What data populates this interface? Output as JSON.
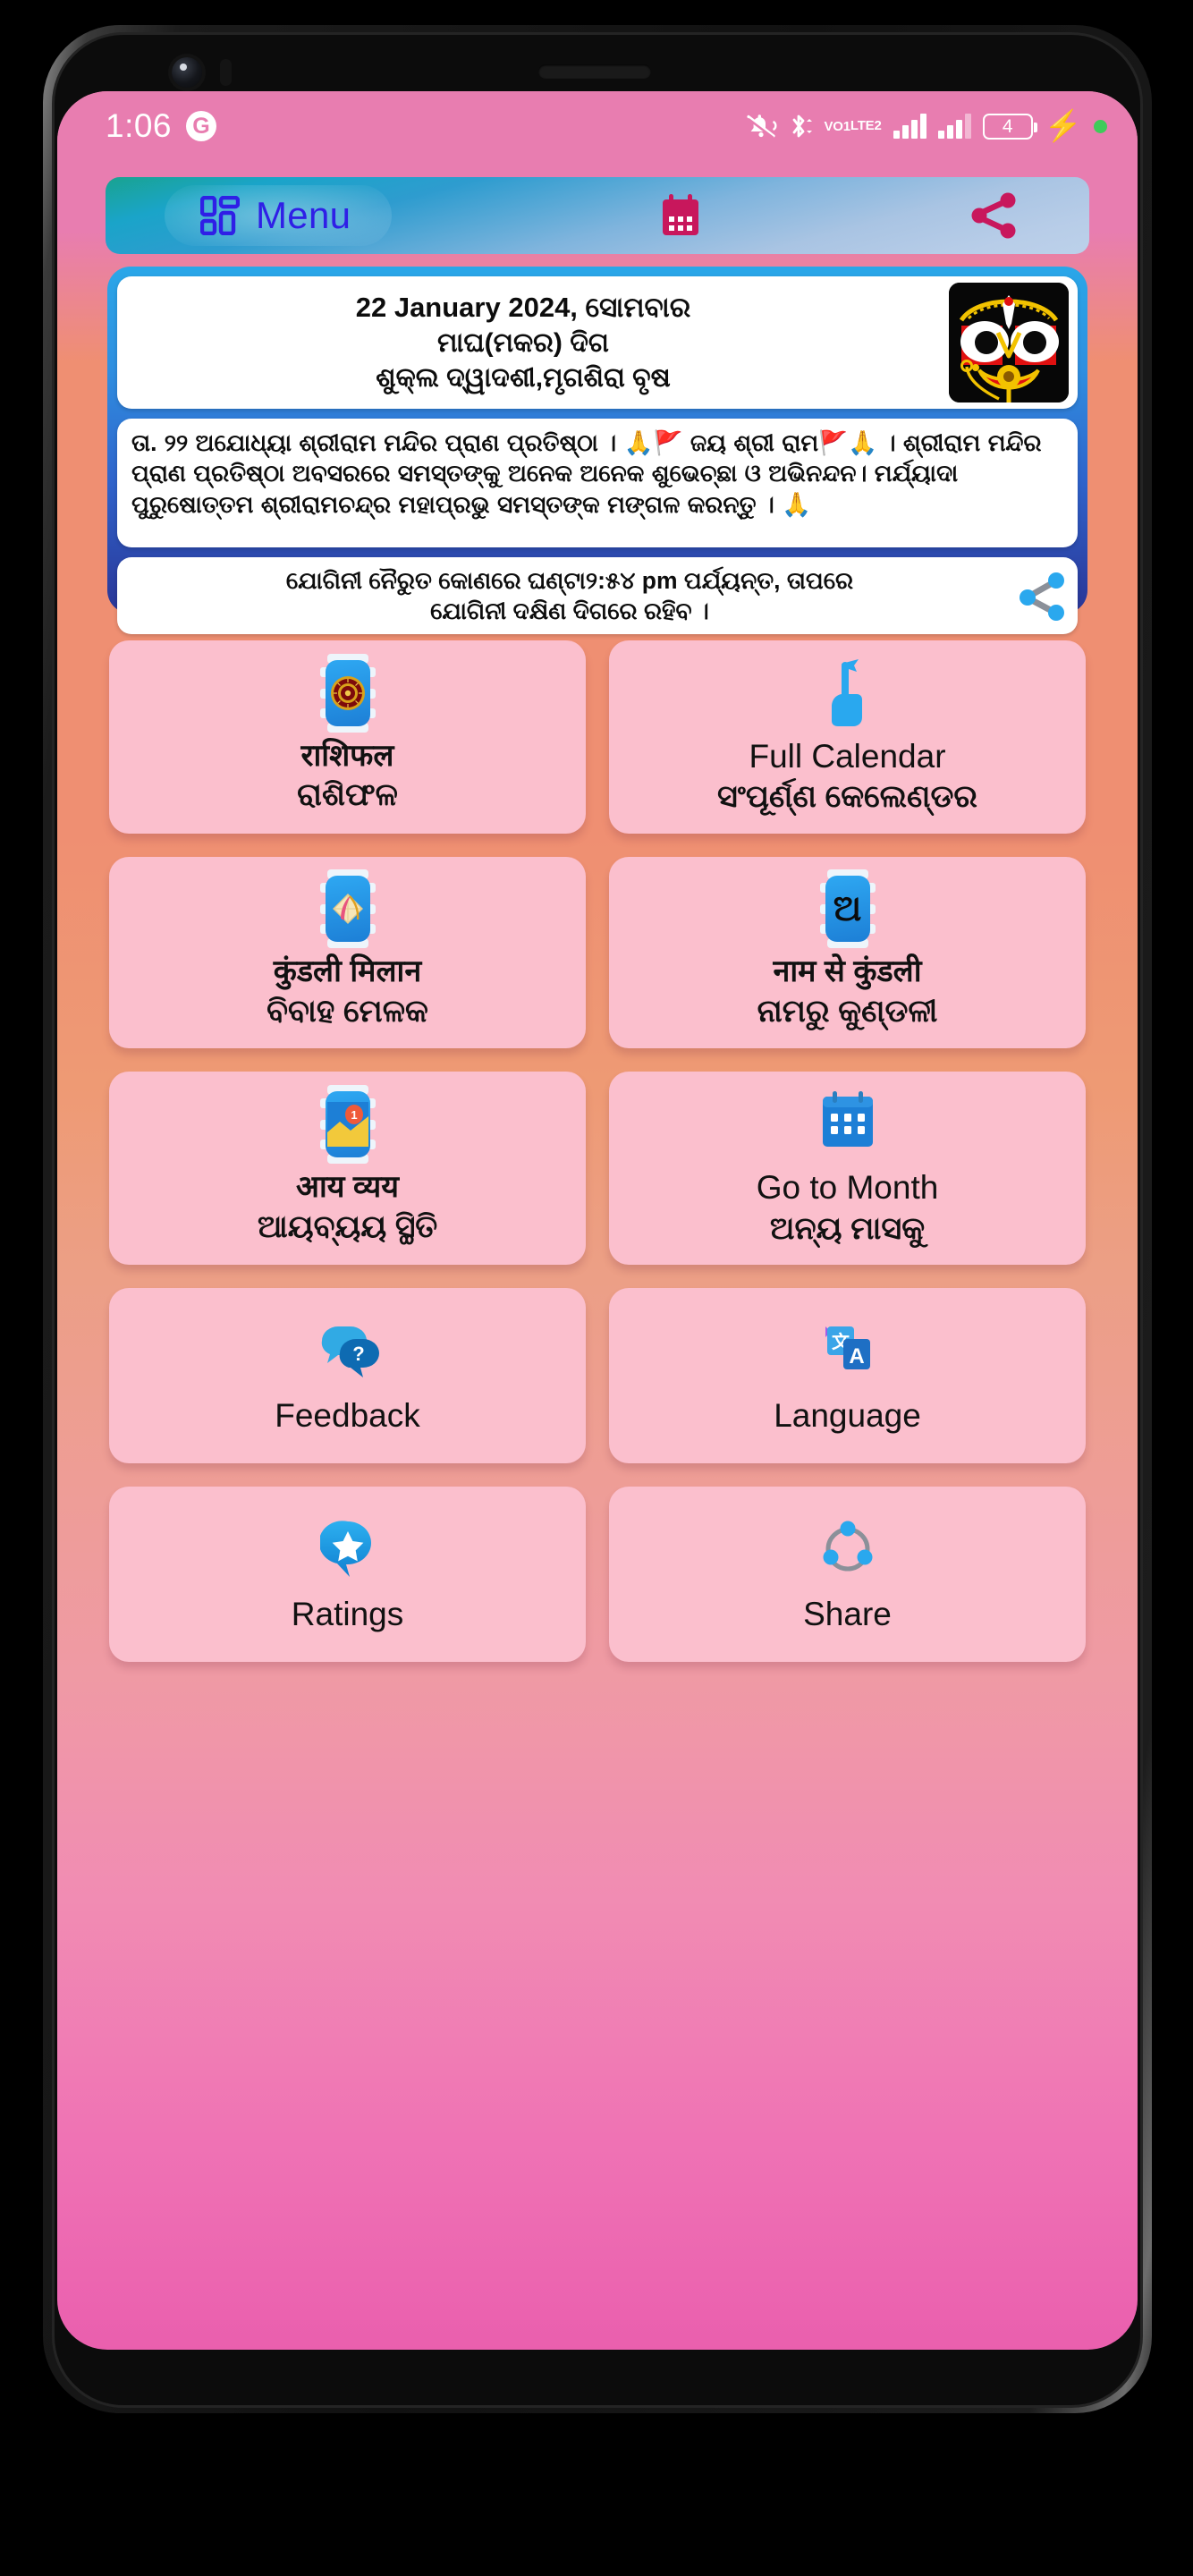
{
  "statusbar": {
    "time": "1:06",
    "g_badge": "G",
    "volte_top": "VO",
    "volte_bottom": "LTE",
    "sim1": "1",
    "sim2": "2",
    "battery_level": "4",
    "icons": [
      "mute-bell-icon",
      "bluetooth-icon",
      "volte-icon",
      "signal-bars-icon",
      "signal-bars-2-icon",
      "battery-icon",
      "charging-bolt-icon",
      "green-dot-icon"
    ]
  },
  "navbar": {
    "menu_label": "Menu",
    "menu_icon": "grid-menu-icon",
    "calendar_icon": "calendar-icon",
    "share_icon": "share-icon"
  },
  "info_panel": {
    "date_card": {
      "line1": "22 January 2024, ସୋମବାର",
      "line2": "ମାଘ(ମକର) ଦିଗ",
      "line3": "ଶୁକ୍ଲ ଦ୍ୱାଦଶୀ,ମୃଗଶିରା ବୃଷ",
      "deity_image": "lord-jagannath-face"
    },
    "news_card": {
      "text": "ତା. ୨୨ ଅଯୋଧ୍ୟା ଶ୍ରୀରାମ ମନ୍ଦିର ପ୍ରାଣ ପ୍ରତିଷ୍ଠା । 🙏🚩 ଜୟ ଶ୍ରୀ ରାମ🚩🙏 । ଶ୍ରୀରାମ ମନ୍ଦିର ପ୍ରାଣ ପ୍ରତିଷ୍ଠା ଅବସରରେ ସମସ୍ତଙ୍କୁ ଅନେକ ଅନେକ ଶୁଭେଚ୍ଛା ଓ ଅଭିନନ୍ଦନ। ମର୍ଯ୍ୟାଦା ପୁରୁଷୋତ୍ତମ ଶ୍ରୀରାମଚନ୍ଦ୍ର ମହାପ୍ରଭୁ ସମସ୍ତଙ୍କ ମଙ୍ଗଳ କରନ୍ତୁ । 🙏"
    },
    "yogini_card": {
      "line1": "ଯୋଗିନୀ ନୈରୁତ କୋଣରେ ଘଣ୍ଟା୨:୫୪ pm ପର୍ଯ୍ୟନ୍ତ, ତାପରେ",
      "line2": "ଯୋଗିନୀ ଦକ୍ଷିଣ ଦିଗରେ ରହିବ ।",
      "share_icon": "share-icon"
    }
  },
  "tiles": [
    {
      "id": "rashifal",
      "icon": "zodiac-wheel-icon",
      "line1": "राशिफल",
      "line2": "ରାଶିଫଳ",
      "l1style": "hin",
      "l2style": "odia"
    },
    {
      "id": "full-calendar",
      "icon": "pointing-hand-icon",
      "line1": "Full Calendar",
      "line2": "ସଂପୂର୍ଣ୍ଣ କେଲେଣ୍ଡର",
      "l1style": "eng",
      "l2style": "odia"
    },
    {
      "id": "kundali-milan",
      "icon": "kundali-match-icon",
      "line1": "कुंडली मिलान",
      "line2": "ବିବାହ ମେଳକ",
      "l1style": "hin",
      "l2style": "odia"
    },
    {
      "id": "naam-kundali",
      "icon": "odia-letter-a-icon",
      "line1": "नाम से कुंडली",
      "line2": "ନାମରୁ କୁଣ୍ଡଳୀ",
      "l1style": "hin",
      "l2style": "odia"
    },
    {
      "id": "aay-vyay",
      "icon": "income-expense-icon",
      "line1": "आय व्यय",
      "line2": "ଆୟବ୍ୟୟ ସ୍ଥିତି",
      "l1style": "hin",
      "l2style": "odia"
    },
    {
      "id": "go-to-month",
      "icon": "calendar-month-icon",
      "line1": "Go to Month",
      "line2": "ଅନ୍ୟ ମାସକୁ",
      "l1style": "eng",
      "l2style": "odia"
    },
    {
      "id": "feedback",
      "icon": "question-bubble-icon",
      "line1": "Feedback",
      "line2": "",
      "l1style": "single",
      "l2style": ""
    },
    {
      "id": "language",
      "icon": "translate-icon",
      "line1": "Language",
      "line2": "",
      "l1style": "single",
      "l2style": ""
    },
    {
      "id": "ratings",
      "icon": "star-bubble-icon",
      "line1": "Ratings",
      "line2": "",
      "l1style": "single",
      "l2style": ""
    },
    {
      "id": "share",
      "icon": "share-network-icon",
      "line1": "Share",
      "line2": "",
      "l1style": "single",
      "l2style": ""
    }
  ],
  "colors": {
    "status_bar": "#e87db0",
    "panel_border_top": "#2aa7e8",
    "panel_border_bottom": "#2a3596",
    "tile_bg": "#fbbfcd",
    "menu_text": "#2f1fe6",
    "nav_icon_crimson": "#c8175c",
    "share_blue": "#2aa8ee"
  }
}
